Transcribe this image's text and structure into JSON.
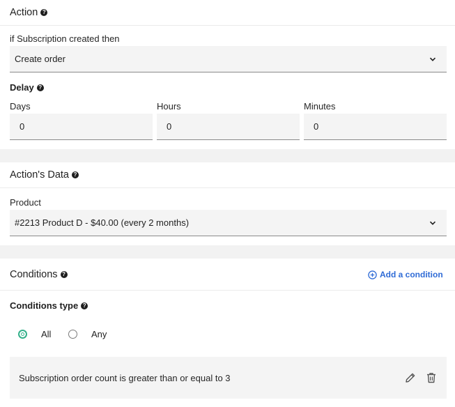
{
  "action": {
    "title": "Action",
    "trigger_label": "if Subscription created then",
    "selected_action": "Create order",
    "delay": {
      "title": "Delay",
      "days_label": "Days",
      "days_value": "0",
      "hours_label": "Hours",
      "hours_value": "0",
      "minutes_label": "Minutes",
      "minutes_value": "0"
    }
  },
  "actions_data": {
    "title": "Action's Data",
    "product_label": "Product",
    "product_value": "#2213 Product D - $40.00 (every 2 months)"
  },
  "conditions": {
    "title": "Conditions",
    "add_label": "Add a condition",
    "type_label": "Conditions type",
    "options": [
      {
        "label": "All",
        "checked": true
      },
      {
        "label": "Any",
        "checked": false
      }
    ],
    "items": [
      {
        "text": "Subscription order count is greater than or equal to 3"
      }
    ]
  },
  "colors": {
    "accent_link": "#2f6bd6",
    "radio_checked": "#34b08a",
    "band": "#f2f2f2",
    "field_bg": "#f4f4f4"
  }
}
